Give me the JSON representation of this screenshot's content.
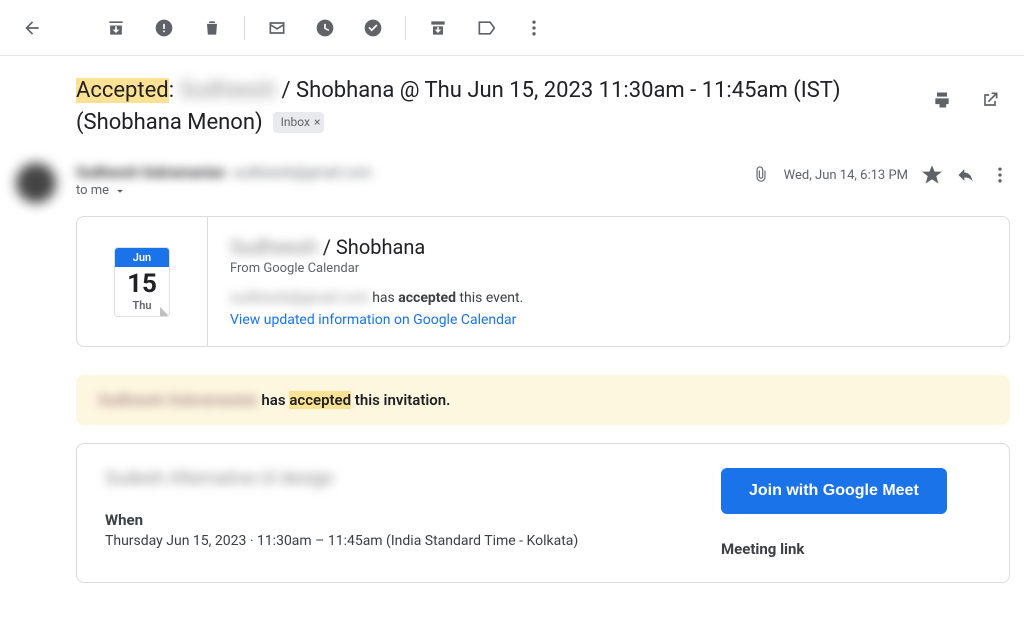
{
  "subject": {
    "accepted": "Accepted",
    "redacted_name": "Sudheesh",
    "title_rest": "/ Shobhana @ Thu Jun 15, 2023 11:30am - 11:45am (IST)",
    "line2": "(Shobhana Menon)"
  },
  "label": {
    "name": "Inbox"
  },
  "sender": {
    "name": "Sudheesh Subramanian",
    "email": "sudheesh@gmail.com",
    "to": "to me"
  },
  "meta": {
    "date": "Wed, Jun 14, 6:13 PM"
  },
  "calendar_tile": {
    "month": "Jun",
    "day": "15",
    "weekday": "Thu"
  },
  "card": {
    "title_redacted": "Sudheesh",
    "title_rest": " / Shobhana",
    "from": "From Google Calendar",
    "who_redacted": "sudheesh@gmail.com",
    "status_prefix": " has ",
    "status_word": "accepted",
    "status_suffix": " this event.",
    "link": "View updated information on Google Calendar"
  },
  "banner": {
    "who_redacted": "Sudheesh Subramanian",
    "prefix": " has ",
    "accepted": "accepted",
    "suffix": " this invitation."
  },
  "event": {
    "title_redacted": "Sudesh Alternative UI design",
    "when_label": "When",
    "when_value": "Thursday Jun 15, 2023 · 11:30am – 11:45am (India Standard Time - Kolkata)",
    "meet_button": "Join with Google Meet",
    "meeting_link_label": "Meeting link"
  }
}
